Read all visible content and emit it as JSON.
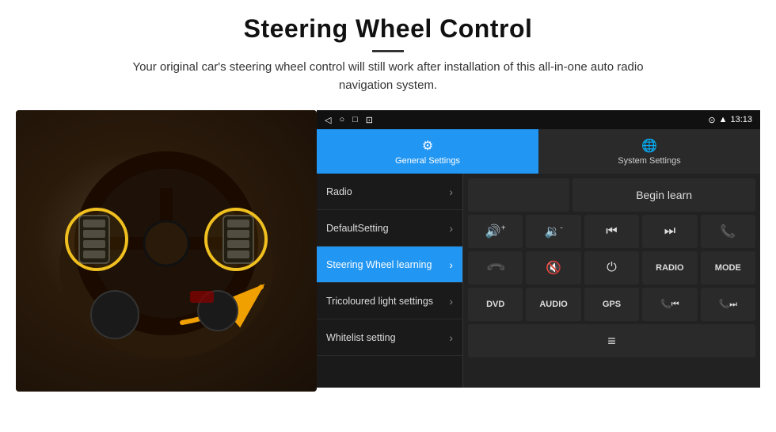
{
  "header": {
    "title": "Steering Wheel Control",
    "description": "Your original car's steering wheel control will still work after installation of this all-in-one auto radio navigation system."
  },
  "status_bar": {
    "left_icons": [
      "◁",
      "○",
      "□",
      "⊡"
    ],
    "time": "13:13",
    "right_icons": [
      "⊙",
      "▲"
    ]
  },
  "tabs": [
    {
      "id": "general",
      "label": "General Settings",
      "active": true,
      "icon": "⚙"
    },
    {
      "id": "system",
      "label": "System Settings",
      "active": false,
      "icon": "🌐"
    }
  ],
  "menu_items": [
    {
      "id": "radio",
      "label": "Radio",
      "active": false
    },
    {
      "id": "default",
      "label": "DefaultSetting",
      "active": false
    },
    {
      "id": "steering",
      "label": "Steering Wheel learning",
      "active": true
    },
    {
      "id": "tricoloured",
      "label": "Tricoloured light settings",
      "active": false
    },
    {
      "id": "whitelist",
      "label": "Whitelist setting",
      "active": false
    }
  ],
  "control": {
    "begin_learn_label": "Begin learn",
    "buttons_row1": [
      {
        "id": "vol-up",
        "icon": "🔊+",
        "label": "vol-up"
      },
      {
        "id": "vol-down",
        "icon": "🔉-",
        "label": "vol-down"
      },
      {
        "id": "prev-track",
        "icon": "⏮",
        "label": "prev-track"
      },
      {
        "id": "next-track",
        "icon": "⏭",
        "label": "next-track"
      },
      {
        "id": "phone",
        "icon": "📞",
        "label": "phone"
      }
    ],
    "buttons_row2": [
      {
        "id": "phone-down",
        "icon": "📵",
        "label": "phone-down"
      },
      {
        "id": "mute",
        "icon": "🔇",
        "label": "mute"
      },
      {
        "id": "power",
        "icon": "⏻",
        "label": "power"
      },
      {
        "id": "radio-btn",
        "label": "RADIO",
        "text": true
      },
      {
        "id": "mode-btn",
        "label": "MODE",
        "text": true
      }
    ],
    "buttons_row3": [
      {
        "id": "dvd",
        "label": "DVD",
        "text": true
      },
      {
        "id": "audio",
        "label": "AUDIO",
        "text": true
      },
      {
        "id": "gps",
        "label": "GPS",
        "text": true
      },
      {
        "id": "phone-prev",
        "icon": "📞⏮",
        "label": "phone-prev"
      },
      {
        "id": "phone-next",
        "icon": "📞⏭",
        "label": "phone-next"
      }
    ],
    "buttons_row4": [
      {
        "id": "list",
        "icon": "≡",
        "label": "list"
      }
    ]
  }
}
